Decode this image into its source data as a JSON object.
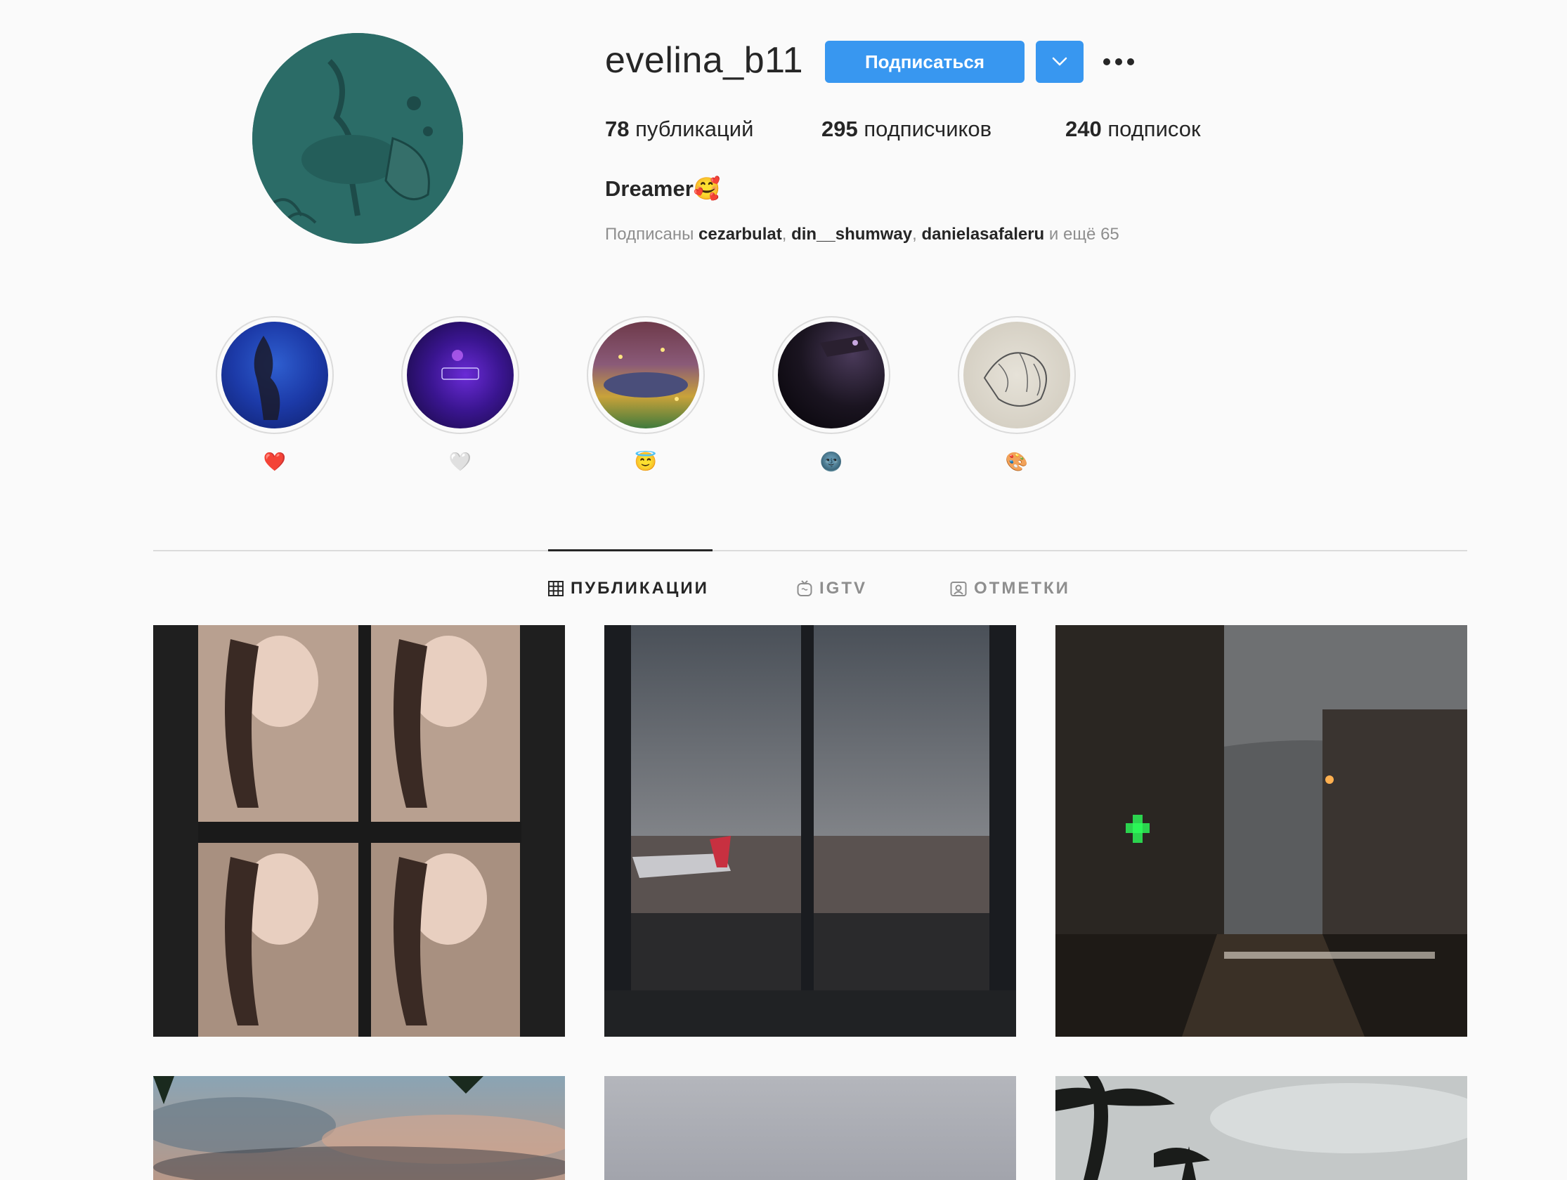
{
  "profile": {
    "username": "evelina_b11",
    "follow_label": "Подписаться",
    "dropdown_icon": "chevron-down-icon",
    "more_icon": "ellipsis-icon",
    "stats": [
      {
        "count": "78",
        "label": "публикаций"
      },
      {
        "count": "295",
        "label": "подписчиков"
      },
      {
        "count": "240",
        "label": "подписок"
      }
    ],
    "bio_name": "Dreamer🥰",
    "followed_by": {
      "prefix": "Подписаны",
      "users": [
        "cezarbulat",
        "din__shumway",
        "danielasafaleru"
      ],
      "suffix": "и ещё 65"
    }
  },
  "highlights": [
    {
      "label": "❤️"
    },
    {
      "label": "🤍"
    },
    {
      "label": "😇"
    },
    {
      "label": "🌚"
    },
    {
      "label": "🎨"
    }
  ],
  "tabs": [
    {
      "label": "ПУБЛИКАЦИИ",
      "icon": "grid-icon",
      "active": true
    },
    {
      "label": "IGTV",
      "icon": "igtv-icon",
      "active": false
    },
    {
      "label": "ОТМЕТКИ",
      "icon": "tagged-icon",
      "active": false
    }
  ],
  "posts_visible": 6,
  "colors": {
    "accent": "#3897f0",
    "text": "#262626",
    "muted": "#8e8e8e",
    "border": "#dbdbdb",
    "background": "#fafafa"
  }
}
